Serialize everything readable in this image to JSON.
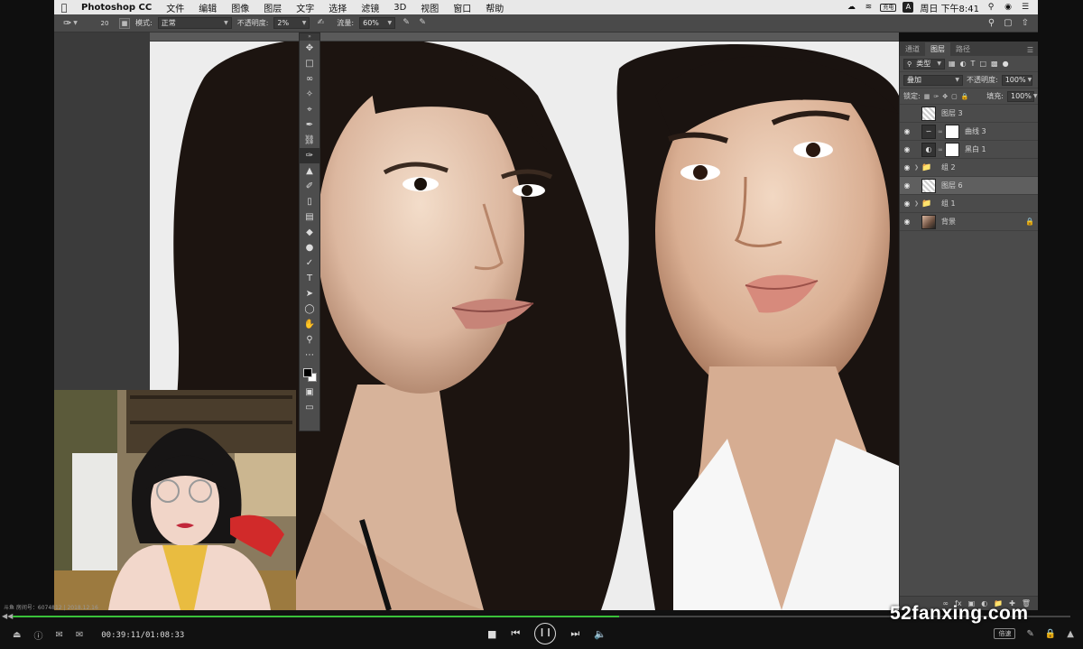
{
  "menubar": {
    "app_name": "Photoshop CC",
    "menus": [
      "文件",
      "编辑",
      "图像",
      "图层",
      "文字",
      "选择",
      "滤镜",
      "3D",
      "视图",
      "窗口",
      "帮助"
    ],
    "battery": "充电",
    "clock": "周日 下午8:41"
  },
  "options": {
    "brush_size": "20",
    "mode_label": "模式:",
    "mode_value": "正常",
    "opacity_label": "不透明度:",
    "opacity_value": "2%",
    "flow_label": "流量:",
    "flow_value": "60%"
  },
  "panel": {
    "tabs": [
      "通道",
      "图层",
      "路径"
    ],
    "active_tab": "图层",
    "filter_label": "类型",
    "blend_mode": "叠加",
    "opacity_label": "不透明度:",
    "opacity_value": "100%",
    "lock_label": "锁定:",
    "fill_label": "填充:",
    "fill_value": "100%",
    "layers": [
      {
        "name": "图层 3",
        "visible": false,
        "kind": "pixel"
      },
      {
        "name": "曲线 3",
        "visible": true,
        "kind": "adjustment"
      },
      {
        "name": "黑白 1",
        "visible": true,
        "kind": "adjustment"
      },
      {
        "name": "组 2",
        "visible": true,
        "kind": "group"
      },
      {
        "name": "图层 6",
        "visible": true,
        "kind": "pixel",
        "selected": true
      },
      {
        "name": "组 1",
        "visible": true,
        "kind": "group"
      },
      {
        "name": "背景",
        "visible": true,
        "kind": "background",
        "locked": true
      }
    ]
  },
  "player": {
    "status_text": "斗鱼 房间号：6074812 | 2018.12.16",
    "time": "00:39:11/01:08:33",
    "progress": 0.573,
    "speed_label": "倍速"
  },
  "watermark": "52fanxing.com",
  "colors": {
    "progress": "#3ac13a",
    "ps_panel": "#4b4b4b",
    "menubar": "#e8e8e8"
  }
}
